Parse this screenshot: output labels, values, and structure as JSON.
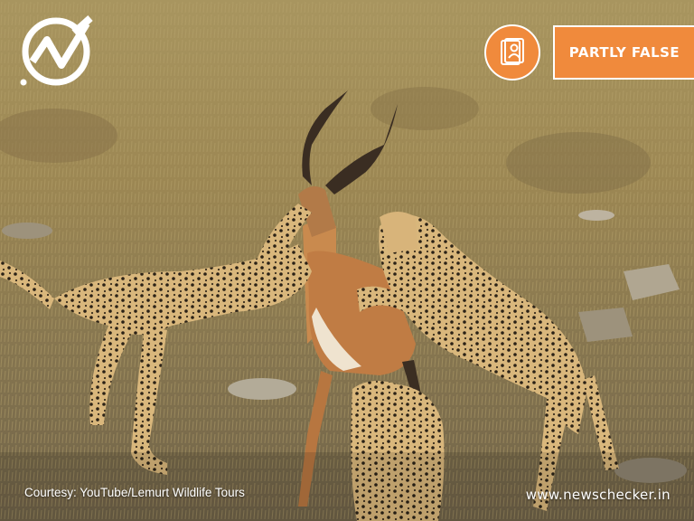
{
  "badge": {
    "verdict_label": "PARTLY FALSE",
    "category_icon": "profile-card-icon",
    "accent_color": "#f08a3c"
  },
  "brand": {
    "logo_icon": "newschecker-logo-icon",
    "website": "www.newschecker.in"
  },
  "photo": {
    "credit": "Courtesy: YouTube/Lemurt Wildlife Tours"
  }
}
